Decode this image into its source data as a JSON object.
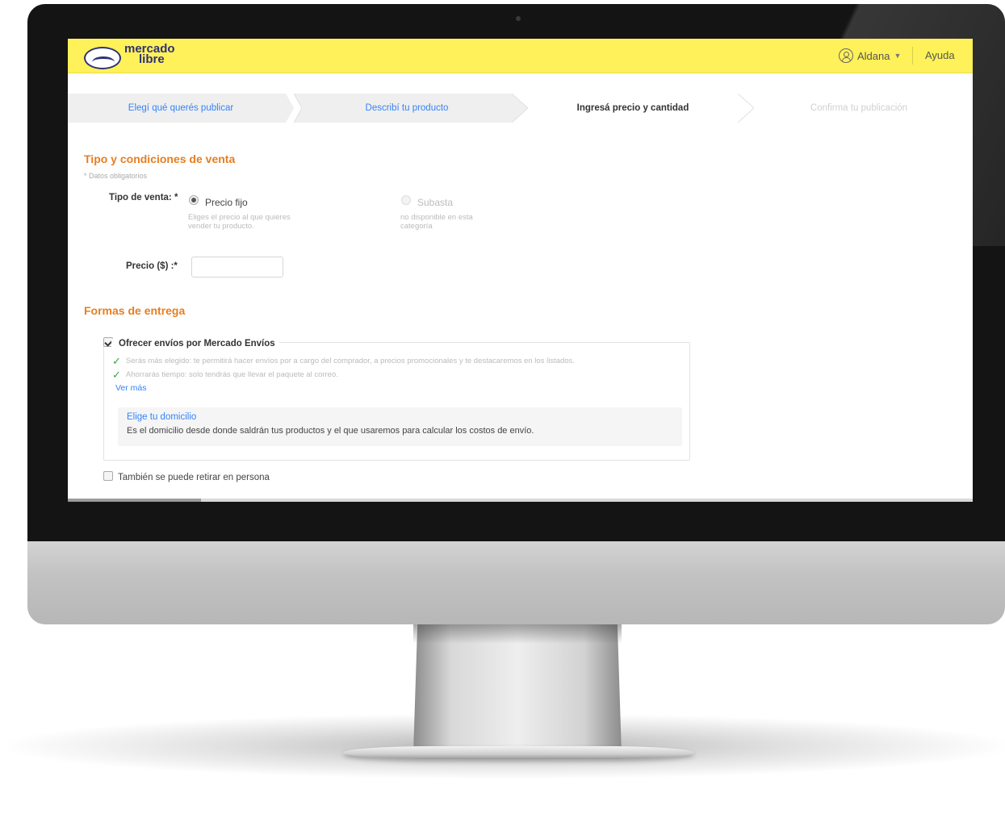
{
  "app": {
    "logo_line1": "mercado",
    "logo_line2": "libre",
    "user_name": "Aldana",
    "help_label": "Ayuda"
  },
  "stepper": {
    "steps": [
      {
        "label": "Elegí qué querés publicar",
        "state": "done"
      },
      {
        "label": "Describí tu producto",
        "state": "done"
      },
      {
        "label": "Ingresá precio y cantidad",
        "state": "active"
      },
      {
        "label": "Confirma tu publicación",
        "state": "pending"
      }
    ]
  },
  "sale_section": {
    "title": "Tipo y condiciones de venta",
    "required_note": "* Datos obligatorios",
    "sale_type_label": "Tipo de venta: *",
    "options": [
      {
        "label": "Precio fijo",
        "help_line1": "Eliges el precio al que quieres",
        "help_line2": "vender tu producto.",
        "selected": true,
        "disabled": false
      },
      {
        "label": "Subasta",
        "help_line1": "no disponible en esta",
        "help_line2": "categoría",
        "selected": false,
        "disabled": true
      }
    ],
    "price_label": "Precio ($) :*",
    "price_value": "",
    "price_placeholder": ""
  },
  "delivery_section": {
    "title": "Formas de entrega",
    "mercado_envios": {
      "label": "Ofrecer envíos por Mercado Envíos",
      "checked": true,
      "benefits": [
        "Serás más elegido: te permitirá hacer envíos por a cargo del comprador, a precios promocionales y te destacaremos en los listados.",
        "Ahorrarás tiempo: solo tendrás que llevar el paquete al correo."
      ],
      "see_more": "Ver más",
      "address_link": "Elige tu domicilio",
      "address_desc": "Es el domicilio desde donde saldrán tus productos y el que usaremos para calcular los costos de envío."
    },
    "pickup": {
      "label": "También se puede retirar en persona",
      "checked": false
    }
  },
  "colors": {
    "brand_yellow": "#fff159",
    "brand_blue": "#2d3277",
    "link_blue": "#3483fa",
    "section_orange": "#e67e22",
    "success_green": "#39a33a"
  }
}
